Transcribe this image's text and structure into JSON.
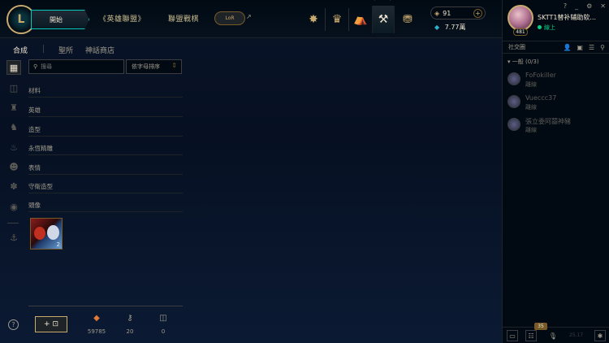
{
  "topbar": {
    "play_label": "開始",
    "nav_league": "《英雄聯盟》",
    "nav_tft": "聯盟戰棋",
    "lor_label": "LoR",
    "lor_arrow": "↗"
  },
  "header_icons": [
    "home-icon",
    "profile-icon",
    "collection-icon",
    "loot-icon",
    "store-icon"
  ],
  "currency": {
    "rp": "91",
    "be": "7.77萬"
  },
  "social": {
    "window_controls": [
      "?",
      "_",
      "⚙",
      "✕"
    ],
    "summoner_name": "SKTT1替补辅助软...",
    "status": "線上",
    "level": "481",
    "header": "社交圈",
    "group_label": "▾ 一般 (0/3)",
    "friends": [
      {
        "name": "FoFokiller",
        "status": "離線"
      },
      {
        "name": "Vueccc37",
        "status": "離線"
      },
      {
        "name": "張立委阿囍神豬",
        "status": "離線"
      }
    ],
    "badge_count": "35",
    "version": "25.17"
  },
  "subtabs": {
    "crafting": "合成",
    "sanctum": "聖所",
    "mythic_shop": "神話商店"
  },
  "search": {
    "placeholder": "搜尋"
  },
  "sort": {
    "label": "依字母排序"
  },
  "categories": [
    "材料",
    "英雄",
    "造型",
    "永恆精雕",
    "表情",
    "守衛造型",
    "頭像"
  ],
  "item": {
    "count": "2"
  },
  "footer": {
    "help": "?",
    "add_label": "+",
    "orange_essence": "59785",
    "keys": "20",
    "chests": "0"
  },
  "colors": {
    "gold": "#c8aa6e",
    "teal": "#0ac8b9",
    "online": "#0acf83",
    "bg": "#010a13"
  }
}
